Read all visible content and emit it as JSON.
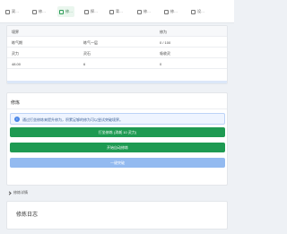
{
  "tabs": [
    {
      "label": "双…",
      "icon": "box-icon"
    },
    {
      "label": "修…",
      "icon": "leaf-icon"
    },
    {
      "label": "修…",
      "icon": "leaf-icon",
      "active": true
    },
    {
      "label": "探…",
      "icon": "compass-icon"
    },
    {
      "label": "背…",
      "icon": "bag-icon"
    },
    {
      "label": "修…",
      "icon": "scroll-icon"
    },
    {
      "label": "修…",
      "icon": "leaf-icon"
    },
    {
      "label": "设…",
      "icon": "gear-icon"
    }
  ],
  "stats": {
    "headers": [
      "境界",
      "修为"
    ],
    "rows": [
      [
        "练气期",
        "练气一层",
        "0 / 100"
      ],
      [
        "灵力",
        "灵石",
        "吸收灵"
      ],
      [
        "48.00",
        "6",
        "0"
      ]
    ],
    "progress": 0.0
  },
  "cultivation": {
    "title": "修炼",
    "notice": "通过打坐修炼来提升修为，积累足够的修为可以尝试突破境界。",
    "buttons": {
      "meditate": "打坐修炼 (消耗 10 灵力)",
      "auto": "开始自动修炼",
      "breakthrough": "一键突破"
    }
  },
  "details": {
    "label": "修炼详情"
  },
  "log": {
    "title": "修炼日志"
  },
  "colors": {
    "primary_green": "#1e9a52",
    "disabled_blue": "#93baf0",
    "notice_bg": "#eef4ff"
  }
}
